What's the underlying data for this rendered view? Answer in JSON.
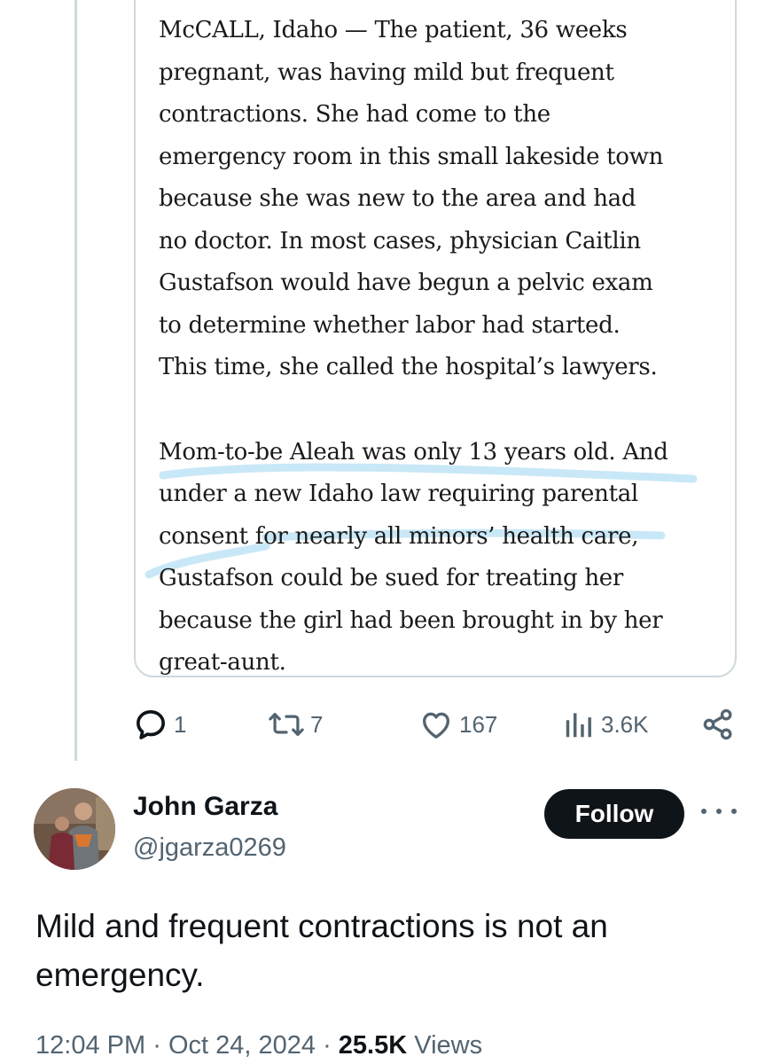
{
  "quoted_article": {
    "paragraph1_lines": [
      "McCALL, Idaho — The patient, 36 weeks",
      "pregnant, was having mild but frequent",
      "contractions. She had come to the",
      "emergency room in this small lakeside town",
      "because she was new to the area and had",
      "no doctor. In most cases, physician Caitlin",
      "Gustafson would have begun a pelvic exam",
      "to determine whether labor had started.",
      "This time, she called the hospital’s lawyers."
    ],
    "paragraph2_lines": [
      "Mom-to-be Aleah was only 13 years old. And",
      "under a new Idaho law requiring parental",
      "consent for nearly all minors’ health care,",
      "Gustafson could be sued for treating her",
      "because the girl had been brought in by her",
      "great-aunt."
    ],
    "highlight_color": "#bfe4f6"
  },
  "quoted_actions": {
    "replies": "1",
    "reposts": "7",
    "likes": "167",
    "views": "3.6K"
  },
  "reply": {
    "author_name": "John Garza",
    "author_handle": "@jgarza0269",
    "follow_label": "Follow",
    "text": "Mild and frequent contractions is not an emergency.",
    "time": "12:04 PM",
    "date": "Oct 24, 2024",
    "separator": "·",
    "views_count": "25.5K",
    "views_label": "Views"
  },
  "colors": {
    "text_primary": "#0f1419",
    "text_secondary": "#536471",
    "border": "#cfd9de",
    "follow_bg": "#0f1419"
  },
  "icons": [
    "reply-icon",
    "repost-icon",
    "like-icon",
    "views-icon",
    "share-icon",
    "more-icon"
  ]
}
